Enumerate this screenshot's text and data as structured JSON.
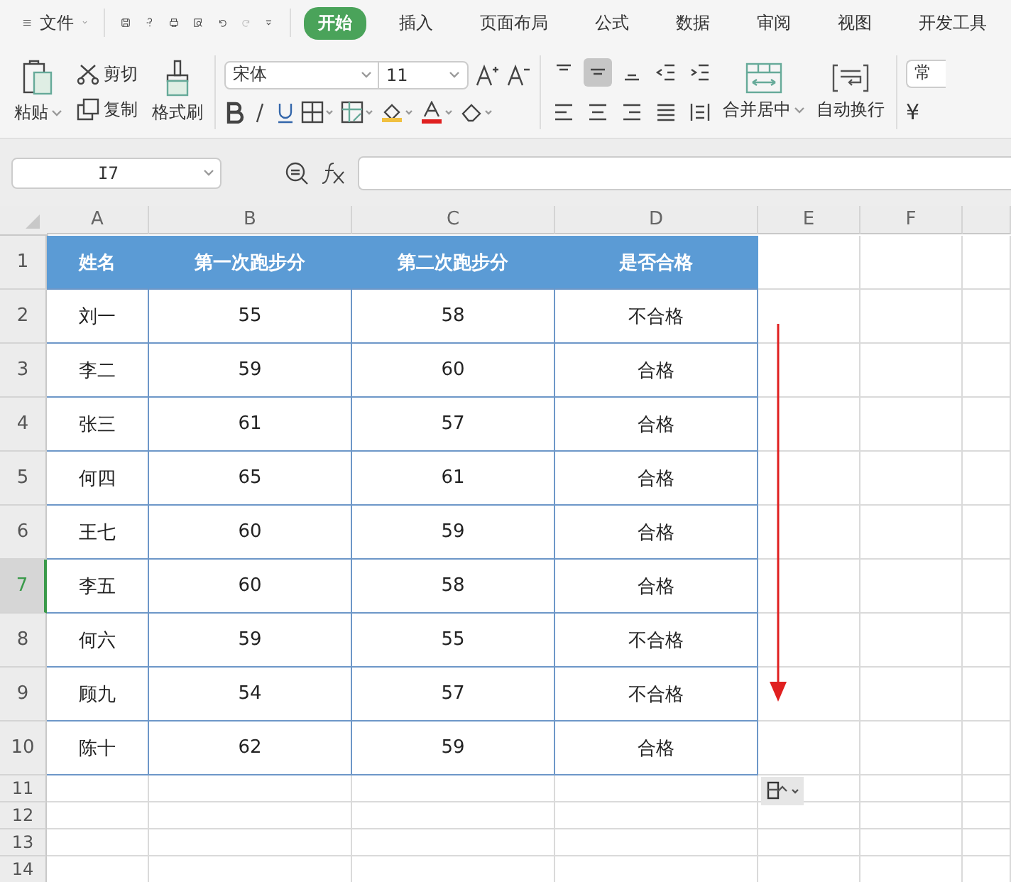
{
  "menu": {
    "file_label": "文件",
    "tabs": [
      {
        "label": "开始",
        "selected": true
      },
      {
        "label": "插入",
        "selected": false
      },
      {
        "label": "页面布局",
        "selected": false
      },
      {
        "label": "公式",
        "selected": false
      },
      {
        "label": "数据",
        "selected": false
      },
      {
        "label": "审阅",
        "selected": false
      },
      {
        "label": "视图",
        "selected": false
      },
      {
        "label": "开发工具",
        "selected": false
      }
    ]
  },
  "ribbon": {
    "paste": "粘贴",
    "cut": "剪切",
    "copy": "复制",
    "format_painter": "格式刷",
    "font_name": "宋体",
    "font_size": "11",
    "align_buttons": [
      {
        "kind": "top",
        "selected": false
      },
      {
        "kind": "middle",
        "selected": true
      },
      {
        "kind": "bottom",
        "selected": false
      },
      {
        "kind": "outdent",
        "selected": false
      },
      {
        "kind": "indent",
        "selected": false
      }
    ],
    "merge": "合并居中",
    "wrap": "自动换行",
    "number_format": "常",
    "currency": "¥"
  },
  "formula_bar": {
    "name_box": "I7"
  },
  "columns": [
    {
      "letter": "A"
    },
    {
      "letter": "B"
    },
    {
      "letter": "C"
    },
    {
      "letter": "D"
    },
    {
      "letter": "E"
    },
    {
      "letter": "F"
    }
  ],
  "rows": [
    {
      "number": "1",
      "selected": false,
      "kind": "header",
      "cells": [
        "姓名",
        "第一次跑步分",
        "第二次跑步分",
        "是否合格"
      ]
    },
    {
      "number": "2",
      "selected": false,
      "kind": "data",
      "cells": [
        "刘一",
        "55",
        "58",
        "不合格"
      ]
    },
    {
      "number": "3",
      "selected": false,
      "kind": "data",
      "cells": [
        "李二",
        "59",
        "60",
        "合格"
      ]
    },
    {
      "number": "4",
      "selected": false,
      "kind": "data",
      "cells": [
        "张三",
        "61",
        "57",
        "合格"
      ]
    },
    {
      "number": "5",
      "selected": false,
      "kind": "data",
      "cells": [
        "何四",
        "65",
        "61",
        "合格"
      ]
    },
    {
      "number": "6",
      "selected": false,
      "kind": "data",
      "cells": [
        "王七",
        "60",
        "59",
        "合格"
      ]
    },
    {
      "number": "7",
      "selected": true,
      "kind": "data",
      "cells": [
        "李五",
        "60",
        "58",
        "合格"
      ]
    },
    {
      "number": "8",
      "selected": false,
      "kind": "data",
      "cells": [
        "何六",
        "59",
        "55",
        "不合格"
      ]
    },
    {
      "number": "9",
      "selected": false,
      "kind": "data",
      "cells": [
        "顾九",
        "54",
        "57",
        "不合格"
      ]
    },
    {
      "number": "10",
      "selected": false,
      "kind": "data",
      "cells": [
        "陈十",
        "62",
        "59",
        "合格"
      ]
    },
    {
      "number": "11",
      "selected": false,
      "kind": "empty"
    },
    {
      "number": "12",
      "selected": false,
      "kind": "empty"
    },
    {
      "number": "13",
      "selected": false,
      "kind": "empty"
    },
    {
      "number": "14",
      "selected": false,
      "kind": "empty"
    }
  ]
}
